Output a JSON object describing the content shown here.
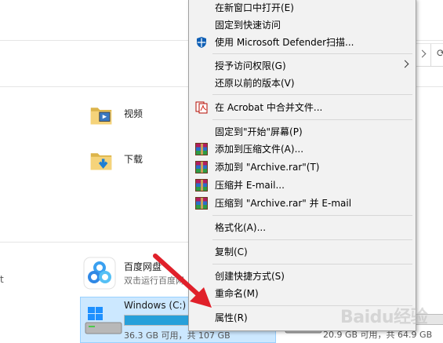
{
  "explorer": {
    "folders": [
      {
        "name": "视频",
        "icon": "video-folder-icon"
      },
      {
        "name": "下载",
        "icon": "downloads-folder-icon"
      }
    ],
    "apps": [
      {
        "name": "百度网盘",
        "subtitle": "双击运行百度网",
        "icon": "baidu-netdisk-icon"
      }
    ],
    "drives": [
      {
        "name": "Windows (C:)",
        "space_text": "36.3 GB 可用，共 107 GB",
        "used_fraction": 0.66,
        "selected": true
      },
      {
        "space_text": "20.9 GB 可用，共 64.9 GB",
        "used_fraction": 0.68,
        "selected": false
      }
    ],
    "left_fragment": "t",
    "colors": {
      "selection": "#cce8ff",
      "bar_fill": "#26a0da",
      "annotation": "#e0202a"
    }
  },
  "context_menu": {
    "items": [
      {
        "label": "在新窗口中打开(E)",
        "icon": null
      },
      {
        "label": "固定到快速访问",
        "icon": null
      },
      {
        "label": "使用 Microsoft Defender扫描...",
        "icon": "defender-shield-icon"
      },
      {
        "label": "授予访问权限(G)",
        "icon": null,
        "submenu": true
      },
      {
        "label": "还原以前的版本(V)",
        "icon": null
      },
      {
        "label": "在 Acrobat 中合并文件...",
        "icon": "acrobat-icon"
      },
      {
        "label": "固定到\"开始\"屏幕(P)",
        "icon": null
      },
      {
        "label": "添加到压缩文件(A)...",
        "icon": "winrar-icon"
      },
      {
        "label": "添加到 \"Archive.rar\"(T)",
        "icon": "winrar-icon"
      },
      {
        "label": "压缩并 E-mail...",
        "icon": "winrar-icon"
      },
      {
        "label": "压缩到 \"Archive.rar\" 并 E-mail",
        "icon": "winrar-icon"
      },
      {
        "label": "格式化(A)...",
        "icon": null
      },
      {
        "label": "复制(C)",
        "icon": null
      },
      {
        "label": "创建快捷方式(S)",
        "icon": null
      },
      {
        "label": "重命名(M)",
        "icon": null
      },
      {
        "label": "属性(R)",
        "icon": null
      }
    ]
  },
  "watermark": "Baidu经验"
}
